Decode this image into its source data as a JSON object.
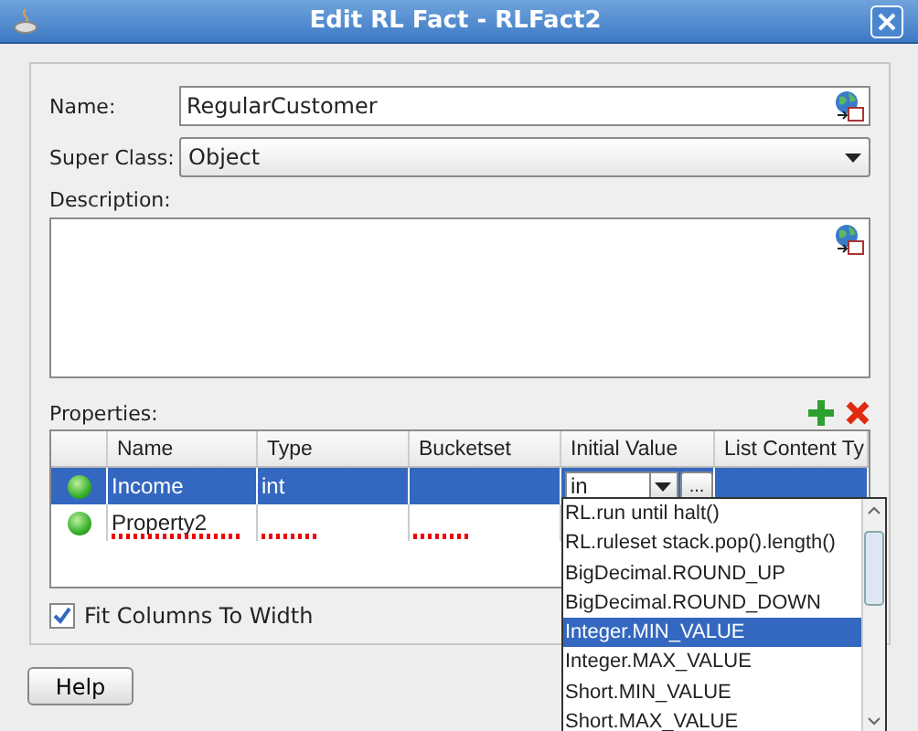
{
  "window": {
    "title": "Edit RL Fact - RLFact2"
  },
  "name": {
    "label": "Name:",
    "value": "RegularCustomer"
  },
  "super_class": {
    "label": "Super Class:",
    "value": "Object"
  },
  "description": {
    "label": "Description:"
  },
  "properties": {
    "label": "Properties:",
    "columns": [
      "Name",
      "Type",
      "Bucketset",
      "Initial Value",
      "List Content Ty"
    ],
    "rows": [
      {
        "name": "Income",
        "type": "int",
        "initial_value": "in",
        "selected": true,
        "error": false
      },
      {
        "name": "Property2",
        "selected": false,
        "error": true
      }
    ]
  },
  "editor_button": "...",
  "fit_columns": {
    "label": "Fit Columns To Width",
    "checked": true
  },
  "help_button": "Help",
  "dropdown": [
    {
      "label": "RL.run until halt()",
      "selected": false
    },
    {
      "label": "RL.ruleset stack.pop().length()",
      "selected": false
    },
    {
      "label": "BigDecimal.ROUND_UP",
      "selected": false
    },
    {
      "label": "BigDecimal.ROUND_DOWN",
      "selected": false
    },
    {
      "label": "Integer.MIN_VALUE",
      "selected": true
    },
    {
      "label": "Integer.MAX_VALUE",
      "selected": false
    },
    {
      "label": "Short.MIN_VALUE",
      "selected": false
    },
    {
      "label": "Short.MAX_VALUE",
      "selected": false
    }
  ]
}
